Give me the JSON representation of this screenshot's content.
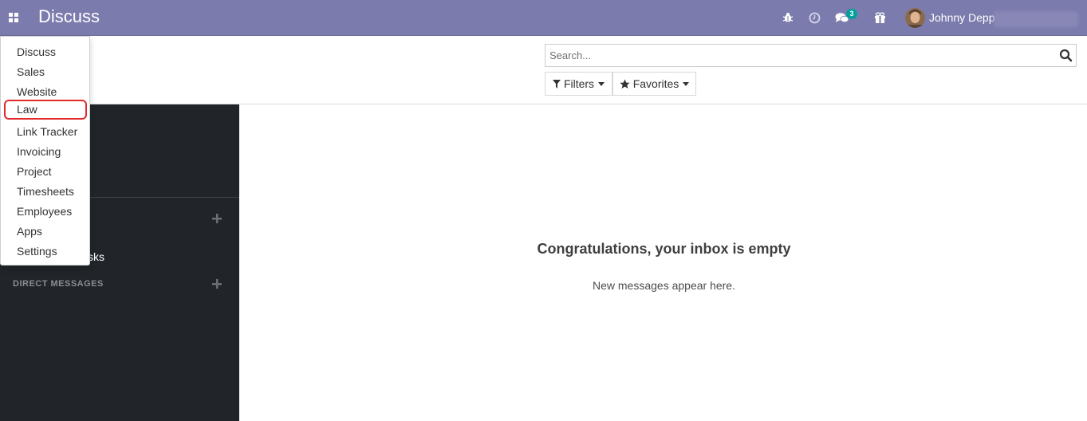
{
  "navbar": {
    "app_title": "Discuss",
    "messages_badge": "3",
    "user_name": "Johnny Depp"
  },
  "apps_menu": {
    "items": [
      {
        "label": "Discuss"
      },
      {
        "label": "Sales"
      },
      {
        "label": "Website"
      },
      {
        "label": "Law",
        "highlighted": true
      },
      {
        "label": "Link Tracker"
      },
      {
        "label": "Invoicing"
      },
      {
        "label": "Project"
      },
      {
        "label": "Timesheets"
      },
      {
        "label": "Employees"
      },
      {
        "label": "Apps"
      },
      {
        "label": "Settings"
      }
    ]
  },
  "search": {
    "placeholder": "Search..."
  },
  "control_panel": {
    "filters_label": "Filters",
    "favorites_label": "Favorites"
  },
  "sidebar": {
    "partial_item_text": "sks",
    "direct_messages_header": "DIRECT MESSAGES"
  },
  "main": {
    "empty_title": "Congratulations, your inbox is empty",
    "empty_subtitle": "New messages appear here."
  },
  "colors": {
    "navbar": "#7c7bad",
    "sidebar": "#212529",
    "badge": "#00a09d",
    "highlight_border": "#e02a2a"
  }
}
